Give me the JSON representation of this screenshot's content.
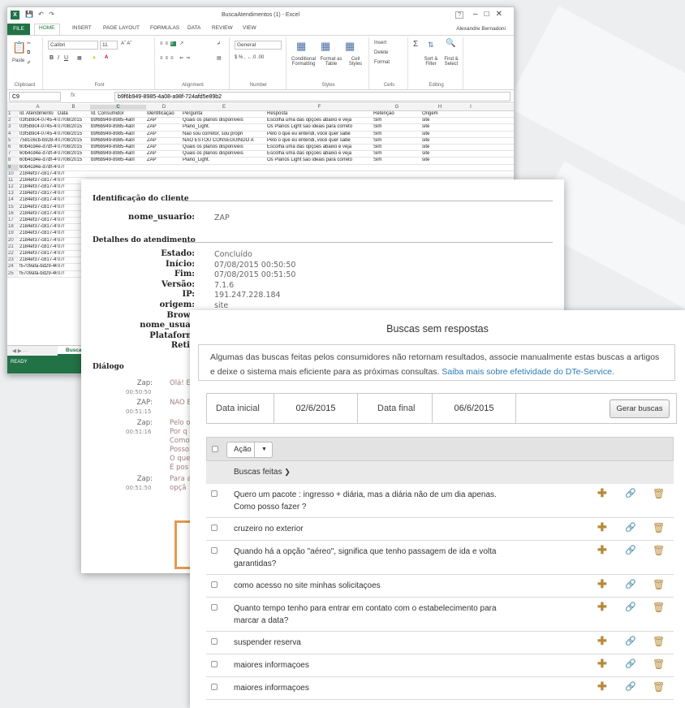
{
  "excel": {
    "window_title": "BuscaAtendimentos (1) - Excel",
    "user": "Alexandre Bernadoni",
    "tabs": [
      "FILE",
      "HOME",
      "INSERT",
      "PAGE LAYOUT",
      "FORMULAS",
      "DATA",
      "REVIEW",
      "VIEW"
    ],
    "ribbon": {
      "font_name": "Calibri",
      "font_size": "11",
      "number_format": "General",
      "groups": [
        "Clipboard",
        "Font",
        "Alignment",
        "Number",
        "Styles",
        "Cells",
        "Editing"
      ],
      "buttons": {
        "paste": "Paste",
        "conditional": "Conditional Formatting",
        "format_table": "Format as Table",
        "cell_styles": "Cell Styles",
        "insert": "Insert",
        "delete": "Delete",
        "format": "Format",
        "sort": "Sort & Filter",
        "find": "Find & Select"
      }
    },
    "name_box": "C9",
    "formula_value": "b9f6b949-8985-4a08-a98f-724afd5e89b2",
    "columns": [
      "A",
      "B",
      "C",
      "D",
      "E",
      "F",
      "G",
      "H",
      "I"
    ],
    "header_row": [
      "Id. Atendimento",
      "Data",
      "Id. Consumidor",
      "Identificação",
      "Pergunta",
      "Resposta",
      "Retenção",
      "Origem"
    ],
    "rows": [
      [
        "03f5b9c4-0745-48a",
        "07/08/2015",
        "b9f6b949-8985-4a0l",
        "ZAP",
        "Quais os planos disponíveis",
        "Escolha uma das opções abaixo e veja",
        "Sim",
        "site"
      ],
      [
        "03f5b9c4-0745-48a",
        "07/08/2015",
        "b9f6b949-8985-4a0l",
        "ZAP",
        "Plano_Light.",
        "Os Planos Light são ideais para correto",
        "Sim",
        "site"
      ],
      [
        "03f5b9c4-0745-48a",
        "07/08/2015",
        "b9f6b949-8985-4a0l",
        "ZAP",
        "Não sou corretor, sou propri",
        "Pelo o que eu entendi, você quer sabe",
        "Sim",
        "site"
      ],
      [
        "7581c6cb-b928-4e",
        "07/08/2015",
        "b9f6b949-8985-4a0l",
        "ZAP",
        "NAO ESTOU CONSEGUINDO A",
        "Pelo o que eu entendi, você quer sabe",
        "Sim",
        "site"
      ],
      [
        "60b4cd4e-d7df-46",
        "07/08/2015",
        "b9f6b949-8985-4a0l",
        "ZAP",
        "Quais os planos disponíveis",
        "Escolha uma das opções abaixo e veja",
        "Sim",
        "site"
      ],
      [
        "60b4cd4e-d7df-46",
        "07/08/2015",
        "b9f6b949-8985-4a0l",
        "ZAP",
        "Quais os planos disponíveis",
        "Escolha uma das opções abaixo e veja",
        "Sim",
        "site"
      ],
      [
        "60b4cd4e-d7df-46",
        "07/08/2015",
        "b9f6b949-8985-4a0l",
        "ZAP",
        "Plano_Light.",
        "Os Planos Light são ideais para correto",
        "Sim",
        "site"
      ],
      [
        "60b4cd4e-d7df-46",
        "07/",
        "",
        "",
        "",
        "",
        "",
        ""
      ],
      [
        "2184ef37-c817-4f2",
        "07/",
        "",
        "",
        "",
        "",
        "",
        ""
      ],
      [
        "2184ef37-c817-4f2",
        "07/",
        "",
        "",
        "",
        "",
        "",
        ""
      ],
      [
        "2184ef37-c817-4f2",
        "07/",
        "",
        "",
        "",
        "",
        "",
        ""
      ],
      [
        "2184ef37-c817-4f2",
        "07/",
        "",
        "",
        "",
        "",
        "",
        ""
      ],
      [
        "2184ef37-c817-4f2",
        "07/",
        "",
        "",
        "",
        "",
        "",
        ""
      ],
      [
        "2184ef37-c817-4f2",
        "07/",
        "",
        "",
        "",
        "",
        "",
        ""
      ],
      [
        "2184ef37-c817-4f2",
        "07/",
        "",
        "",
        "",
        "",
        "",
        ""
      ],
      [
        "2184ef37-c817-4f2",
        "07/",
        "",
        "",
        "",
        "",
        "",
        ""
      ],
      [
        "2184ef37-c817-4f2",
        "07/",
        "",
        "",
        "",
        "",
        "",
        ""
      ],
      [
        "2184ef37-c817-4f2",
        "07/",
        "",
        "",
        "",
        "",
        "",
        ""
      ],
      [
        "2184ef37-c817-4f2",
        "07/",
        "",
        "",
        "",
        "",
        "",
        ""
      ],
      [
        "2184ef37-c817-4f2",
        "07/",
        "",
        "",
        "",
        "",
        "",
        ""
      ],
      [
        "2184ef37-c817-4f2",
        "07/",
        "",
        "",
        "",
        "",
        "",
        ""
      ],
      [
        "2184ef37-c817-4f2",
        "07/",
        "",
        "",
        "",
        "",
        "",
        ""
      ],
      [
        "f5709afa-bd29-46l",
        "07/",
        "",
        "",
        "",
        "",
        "",
        ""
      ],
      [
        "f5709afa-bd29-46l",
        "07/",
        "",
        "",
        "",
        "",
        "",
        ""
      ]
    ],
    "sheet_tab": "BuscaAte",
    "status": "READY"
  },
  "detail": {
    "client_section": "Identificação do cliente",
    "client_fields": [
      {
        "label": "nome_usuario:",
        "value": "ZAP"
      }
    ],
    "service_section": "Detalhes do atendimento",
    "service_fields": [
      {
        "label": "Estado:",
        "value": "Concluído"
      },
      {
        "label": "Início:",
        "value": "07/08/2015 00:50:50"
      },
      {
        "label": "Fim:",
        "value": "07/08/2015 00:51:50"
      },
      {
        "label": "Versão:",
        "value": "7.1.6"
      },
      {
        "label": "IP:",
        "value": "191.247.228.184"
      },
      {
        "label": "origem:",
        "value": "site"
      },
      {
        "label": "Brows",
        "value": ""
      },
      {
        "label": "nome_usuar",
        "value": ""
      },
      {
        "label": "Plataform",
        "value": ""
      },
      {
        "label": "Retic",
        "value": ""
      }
    ],
    "dialog_section": "Diálogo",
    "dialog": [
      {
        "who": "Zap:",
        "time": "00:50:50",
        "msg": "Olá! E"
      },
      {
        "who": "ZAP:",
        "time": "00:51:15",
        "msg": "NAO E"
      },
      {
        "who": "Zap:",
        "time": "00:51:16",
        "msg": "Pelo o"
      },
      {
        "who": "",
        "time": "",
        "msg": "Por q"
      },
      {
        "who": "",
        "time": "",
        "msg": "Como"
      },
      {
        "who": "",
        "time": "",
        "msg": "Posso"
      },
      {
        "who": "",
        "time": "",
        "msg": "O que"
      },
      {
        "who": "",
        "time": "",
        "msg": "É pos"
      },
      {
        "who": "Zap:",
        "time": "00:51:50",
        "msg": "Para a"
      },
      {
        "who": "",
        "time": "",
        "msg": "opçã"
      }
    ]
  },
  "buscas": {
    "title": "Buscas sem respostas",
    "info_text": "Algumas das buscas feitas pelos consumidores não retornam resultados, associe manualmente estas buscas a artigos e deixe o sistema mais eficiente para as próximas consultas. ",
    "info_link": "Saiba mais sobre efetividade do DTe-Service.",
    "date_start_label": "Data inicial",
    "date_start": "02/6/2015",
    "date_end_label": "Data final",
    "date_end": "06/6/2015",
    "generate_button": "Gerar buscas",
    "action_label": "Ação",
    "column_header": "Buscas feitas",
    "items": [
      "Quero um pacote : ingresso + diária, mas a diária não de um dia apenas. Como posso fazer ?",
      "cruzeiro no exterior",
      "Quando há a opção \"aéreo\", significa que tenho passagem de ida e volta garantidas?",
      "como acesso no site minhas solicitaçoes",
      "Quanto tempo tenho para entrar em contato com o estabelecimento para marcar a data?",
      "suspender reserva",
      "maiores informaçoes",
      "maiores informaçoes"
    ]
  }
}
